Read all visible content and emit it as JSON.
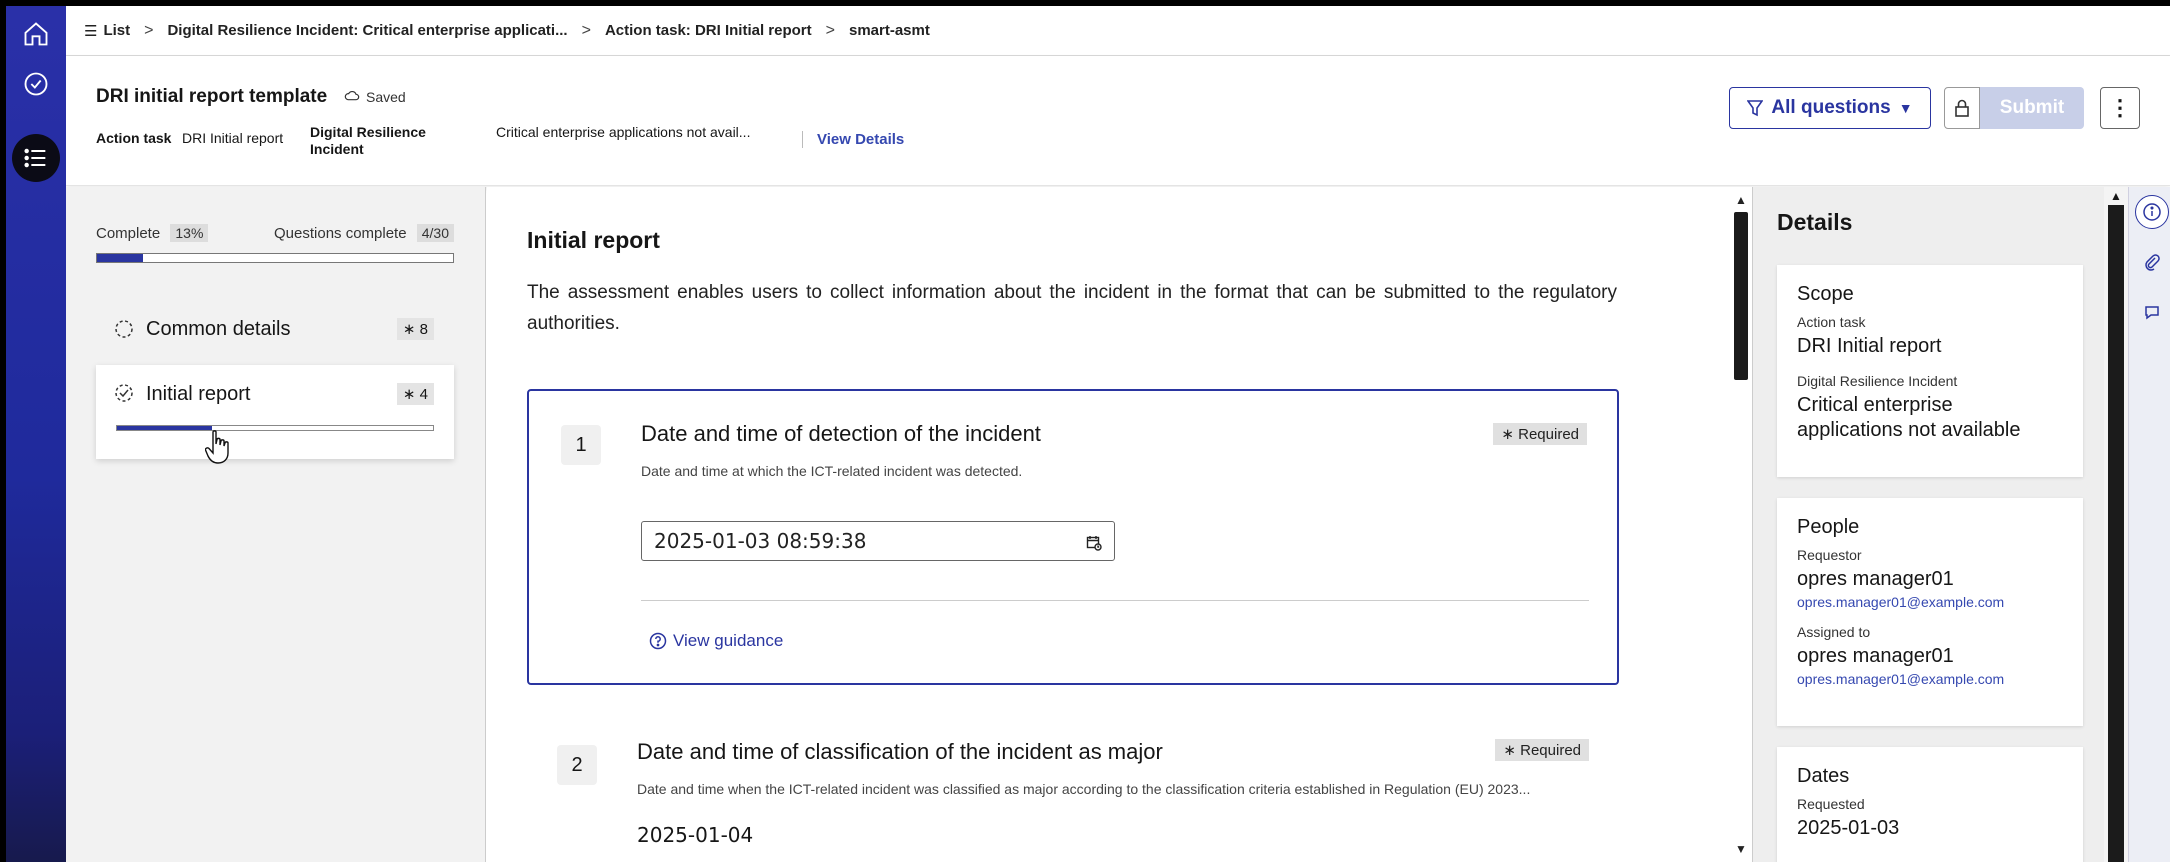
{
  "breadcrumb": {
    "list_label": "List",
    "crumb1": "Digital Resilience Incident: Critical enterprise applicati...",
    "crumb2": "Action task: DRI Initial report",
    "crumb3": "smart-asmt"
  },
  "header": {
    "title": "DRI initial report template",
    "saved": "Saved",
    "action_task_label": "Action task",
    "action_task_value": "DRI Initial report",
    "incident_label": "Digital Resilience Incident",
    "incident_value": "Critical enterprise applications not avail...",
    "view_details": "View Details",
    "filter_label": "All questions",
    "submit_label": "Submit"
  },
  "nav": {
    "complete_label": "Complete",
    "complete_value": "13%",
    "complete_fraction": 0.13,
    "questions_label": "Questions complete",
    "questions_value": "4/30",
    "sections": [
      {
        "name": "Common details",
        "count": "∗ 8"
      },
      {
        "name": "Initial report",
        "count": "∗ 4",
        "progress": 0.3
      }
    ]
  },
  "content": {
    "section_title": "Initial report",
    "section_desc": "The assessment enables users to collect information about the incident in the format that can be submitted to the regulatory authorities.",
    "q1": {
      "num": "1",
      "title": "Date and time of detection of the incident",
      "sub": "Date and time at which the ICT-related incident was detected.",
      "required": "∗ Required",
      "value": "2025-01-03 08:59:38",
      "guidance": "View guidance"
    },
    "q2": {
      "num": "2",
      "title": "Date and time of classification of the incident as major",
      "sub": "Date and time when the ICT-related incident was classified as major according to the classification criteria established in Regulation (EU) 2023...",
      "required": "∗ Required",
      "value": "2025-01-04"
    }
  },
  "details": {
    "title": "Details",
    "scope": {
      "heading": "Scope",
      "action_task_label": "Action task",
      "action_task_value": "DRI Initial report",
      "incident_label": "Digital Resilience Incident",
      "incident_value": "Critical enterprise applications not available"
    },
    "people": {
      "heading": "People",
      "requestor_label": "Requestor",
      "requestor_name": "opres manager01",
      "requestor_email": "opres.manager01@example.com",
      "assigned_label": "Assigned to",
      "assigned_name": "opres manager01",
      "assigned_email": "opres.manager01@example.com"
    },
    "dates": {
      "heading": "Dates",
      "requested_label": "Requested",
      "requested_value": "2025-01-03"
    }
  },
  "colors": {
    "accent": "#2a35a0",
    "rail": "#2a30a8"
  },
  "icons": [
    "home-icon",
    "check-circle-icon",
    "list-icon",
    "cloud-icon",
    "filter-icon",
    "lock-icon",
    "calendar-icon",
    "help-icon",
    "info-icon",
    "paperclip-icon",
    "comment-icon"
  ]
}
